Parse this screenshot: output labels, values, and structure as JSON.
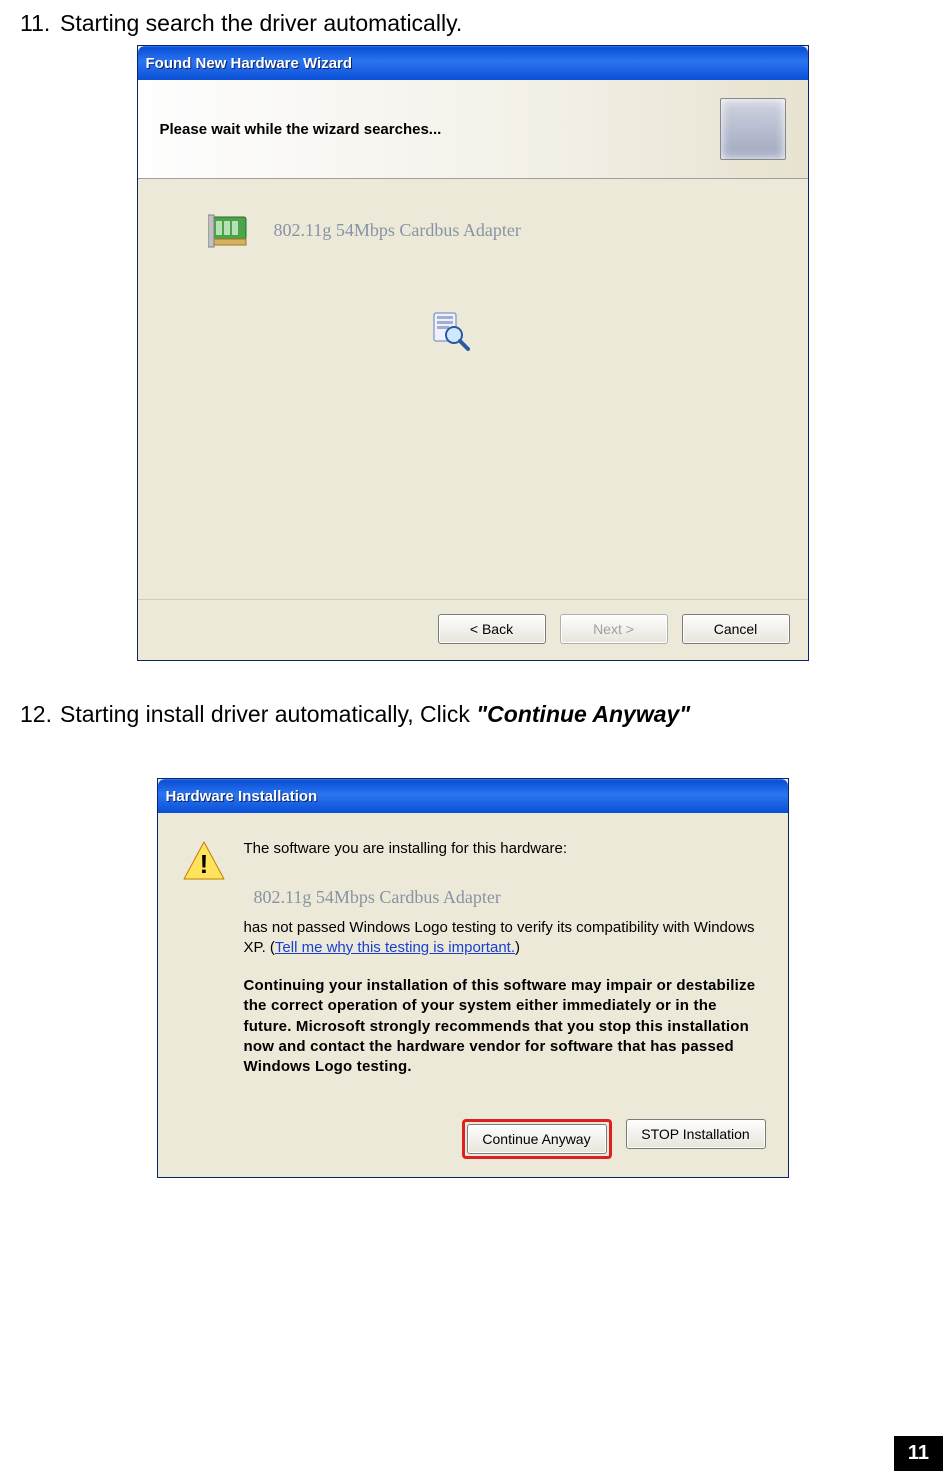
{
  "step11": {
    "number": "11.",
    "text": "Starting search the driver automatically."
  },
  "step12": {
    "number": "12.",
    "text_pre": "Starting install driver automatically, Click ",
    "emph": "\"Continue Anyway\""
  },
  "dialog1": {
    "title": "Found New Hardware Wizard",
    "heading": "Please wait while the wizard searches...",
    "device": "802.11g 54Mbps Cardbus Adapter",
    "buttons": {
      "back": "< Back",
      "next": "Next >",
      "cancel": "Cancel"
    }
  },
  "dialog2": {
    "title": "Hardware Installation",
    "p1": "The software you are installing for this hardware:",
    "device": "802.11g 54Mbps Cardbus Adapter",
    "p2a": "has not passed Windows Logo testing to verify its compatibility with Windows XP. (",
    "link": "Tell me why this testing is important.",
    "p2b": ")",
    "p3": "Continuing your installation of this software may impair or destabilize the correct operation of your system either immediately or in the future. Microsoft strongly recommends that you stop this installation now and contact the hardware vendor for software that has passed Windows Logo testing.",
    "buttons": {
      "continue": "Continue Anyway",
      "stop": "STOP Installation"
    }
  },
  "page_number": "11"
}
